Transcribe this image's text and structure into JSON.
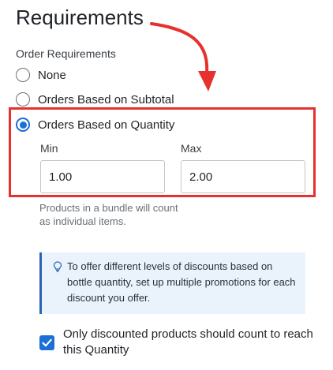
{
  "page": {
    "title": "Requirements",
    "section_label": "Order Requirements"
  },
  "options": [
    {
      "label": "None",
      "selected": false
    },
    {
      "label": "Orders Based on Subtotal",
      "selected": false
    },
    {
      "label": "Orders Based on Quantity",
      "selected": true
    }
  ],
  "quantity": {
    "min_label": "Min",
    "min_value": "1.00",
    "max_label": "Max",
    "max_value": "2.00",
    "helper_text": "Products in a bundle will count as individual items."
  },
  "callout": {
    "icon": "lightbulb-icon",
    "text": "To offer different levels of discounts based on bottle quantity, set up multiple promotions for each discount you offer."
  },
  "discounted_only": {
    "checked": true,
    "label": "Only discounted products should count to reach this Quantity"
  },
  "colors": {
    "accent": "#1b6fd6",
    "annotation_red": "#e5322d",
    "callout_bg": "#eaf3fb",
    "callout_border": "#2a63b6"
  }
}
